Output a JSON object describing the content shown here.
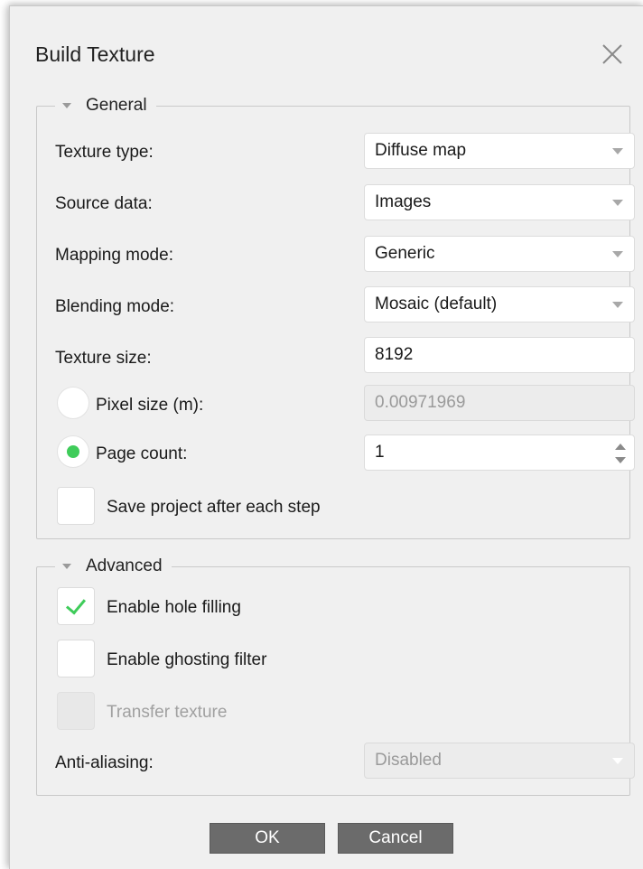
{
  "dialog": {
    "title": "Build Texture",
    "close_icon": "close-icon"
  },
  "general": {
    "legend": "General",
    "texture_type": {
      "label": "Texture type:",
      "value": "Diffuse map"
    },
    "source_data": {
      "label": "Source data:",
      "value": "Images"
    },
    "mapping_mode": {
      "label": "Mapping mode:",
      "value": "Generic"
    },
    "blending_mode": {
      "label": "Blending mode:",
      "value": "Mosaic (default)"
    },
    "texture_size": {
      "label": "Texture size:",
      "value": "8192"
    },
    "pixel_size": {
      "label": "Pixel size (m):",
      "value": "0.00971969",
      "selected": false
    },
    "page_count": {
      "label": "Page count:",
      "value": "1",
      "selected": true
    },
    "save_project": {
      "label": "Save project after each step",
      "checked": false
    }
  },
  "advanced": {
    "legend": "Advanced",
    "hole_filling": {
      "label": "Enable hole filling",
      "checked": true
    },
    "ghosting_filter": {
      "label": "Enable ghosting filter",
      "checked": false
    },
    "transfer_texture": {
      "label": "Transfer texture",
      "checked": false,
      "disabled": true
    },
    "anti_aliasing": {
      "label": "Anti-aliasing:",
      "value": "Disabled",
      "disabled": true
    }
  },
  "buttons": {
    "ok": "OK",
    "cancel": "Cancel"
  },
  "colors": {
    "accent_green": "#3fcc5a",
    "button_bg": "#6b6b6b",
    "dialog_bg": "#f0f0f0"
  }
}
